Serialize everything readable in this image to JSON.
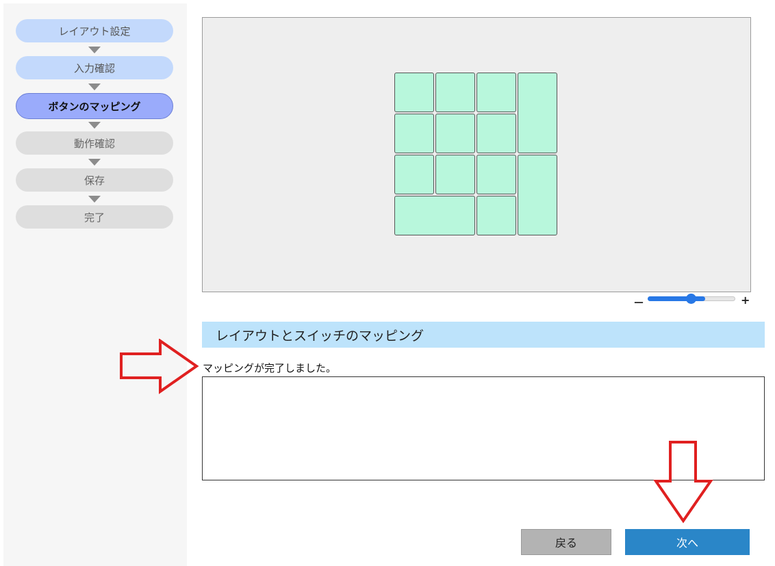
{
  "steps": [
    {
      "label": "レイアウト設定",
      "state": "done"
    },
    {
      "label": "入力確認",
      "state": "done"
    },
    {
      "label": "ボタンのマッピング",
      "state": "active"
    },
    {
      "label": "動作確認",
      "state": "todo"
    },
    {
      "label": "保存",
      "state": "todo"
    },
    {
      "label": "完了",
      "state": "todo"
    }
  ],
  "zoom": {
    "minus": "－",
    "plus": "+",
    "level": 0.6
  },
  "section": {
    "title": "レイアウトとスイッチのマッピング"
  },
  "status_message": "マッピングが完了しました。",
  "buttons": {
    "back": "戻る",
    "next": "次へ"
  },
  "colors": {
    "key_fill": "#b8f7dc",
    "accent": "#2a86c8",
    "annotation": "#e02020"
  }
}
